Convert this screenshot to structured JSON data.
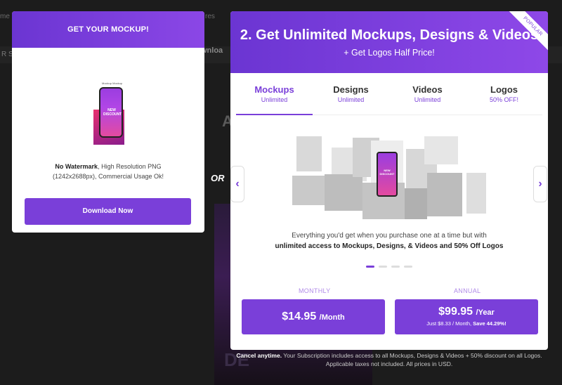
{
  "background": {
    "nav": [
      "me",
      "res"
    ],
    "strip_label": "R S",
    "download_fragment": "wnloa",
    "letter": "A",
    "poster_text": "DE"
  },
  "left_card": {
    "header": "GET YOUR MOCKUP!",
    "phone_small": "Mockup Mockup",
    "phone_text": "NEW DISCOUNT",
    "desc_bold": "No Watermark",
    "desc_rest": ", High Resolution PNG (1242x2688px), Commercial Usage Ok!",
    "button": "Download Now"
  },
  "or_text": "OR",
  "right_card": {
    "title": "2. Get Unlimited Mockups, Designs & Videos",
    "subtitle": "+ Get Logos Half Price!",
    "ribbon": "POPULAR",
    "tabs": [
      {
        "label": "Mockups",
        "sub": "Unlimited",
        "active": true
      },
      {
        "label": "Designs",
        "sub": "Unlimited",
        "active": false
      },
      {
        "label": "Videos",
        "sub": "Unlimited",
        "active": false
      },
      {
        "label": "Logos",
        "sub": "50% OFF!",
        "active": false
      }
    ],
    "collage_phone_text": "NEW DISCOUNT",
    "desc_line1": "Everything you'd get when you purchase one at a time but with",
    "desc_line2": "unlimited access to Mockups, Designs, & Videos and 50% Off Logos",
    "carousel": {
      "pages": 4,
      "current": 1
    },
    "arrows": {
      "prev": "‹",
      "next": "›"
    },
    "plans": {
      "monthly": {
        "label": "MONTHLY",
        "price": "$14.95",
        "unit": "/Month"
      },
      "annual": {
        "label": "ANNUAL",
        "price": "$99.95",
        "unit": "/Year",
        "note_pre": "Just $8.33 / Month, ",
        "note_bold": "Save 44.29%!"
      }
    }
  },
  "footnote": {
    "bold": "Cancel anytime.",
    "line1": " Your Subscription includes access to all Mockups, Designs & Videos + 50% discount on all Logos.",
    "line2": "Applicable taxes not included. All prices in USD."
  },
  "colors": {
    "accent": "#7a3fd9",
    "header_start": "#6b35d2",
    "header_end": "#8e48e8"
  }
}
